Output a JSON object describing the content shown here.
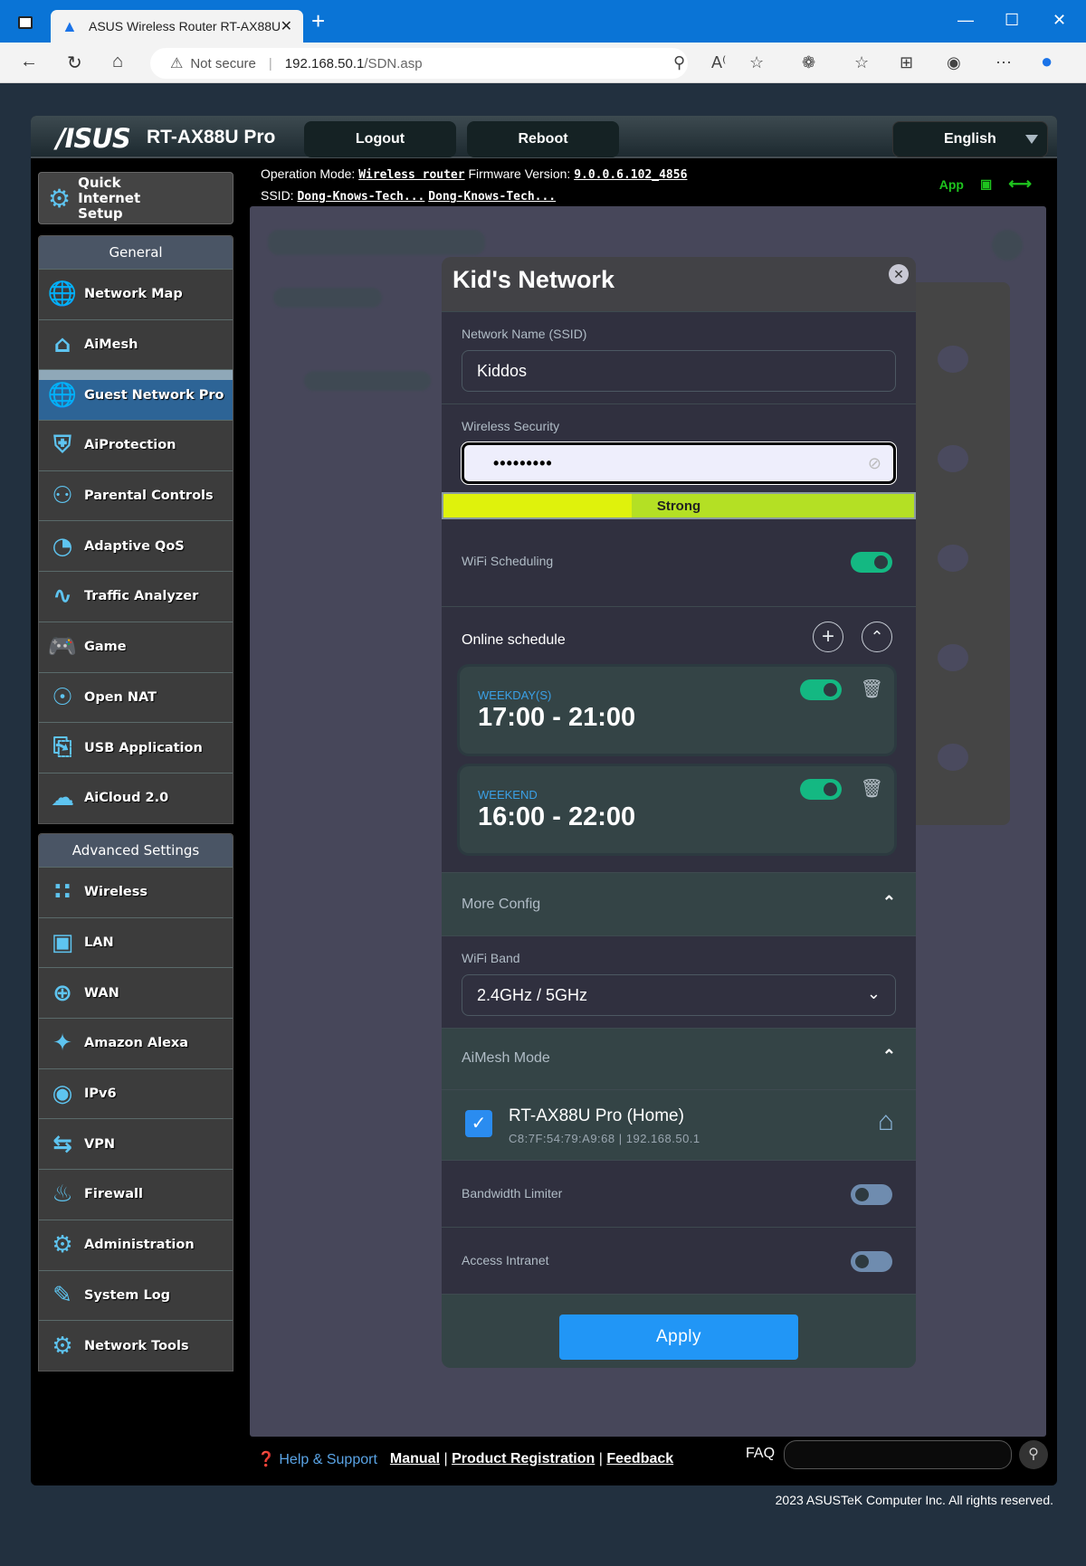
{
  "browser": {
    "tab_title": "ASUS Wireless Router RT-AX88U",
    "security_label": "Not secure",
    "url_host": "192.168.50.1",
    "url_path": "/SDN.asp"
  },
  "router": {
    "brand": "/ISUS",
    "model": "RT-AX88U Pro",
    "logout_label": "Logout",
    "reboot_label": "Reboot",
    "language": "English",
    "operation_mode_label": "Operation Mode:",
    "operation_mode": "Wireless router",
    "firmware_label": "Firmware Version:",
    "firmware": "9.0.0.6.102_4856",
    "ssid_label": "SSID:",
    "ssid_1": "Dong-Knows-Tech...",
    "ssid_2": "Dong-Knows-Tech...",
    "app_label": "App"
  },
  "sidebar": {
    "quick_setup": "Quick Internet Setup",
    "general_header": "General",
    "general_items": [
      {
        "label": "Network Map",
        "icon": "globe-pin-icon"
      },
      {
        "label": "AiMesh",
        "icon": "mesh-house-icon"
      },
      {
        "label": "Guest Network Pro",
        "icon": "guest-globe-icon",
        "active": true
      },
      {
        "label": "AiProtection",
        "icon": "shield-lock-icon"
      },
      {
        "label": "Parental Controls",
        "icon": "family-lock-icon"
      },
      {
        "label": "Adaptive QoS",
        "icon": "speedometer-icon"
      },
      {
        "label": "Traffic Analyzer",
        "icon": "pulse-icon"
      },
      {
        "label": "Game",
        "icon": "gamepad-icon"
      },
      {
        "label": "Open NAT",
        "icon": "open-nat-icon"
      },
      {
        "label": "USB Application",
        "icon": "usb-drive-icon"
      },
      {
        "label": "AiCloud 2.0",
        "icon": "cloud-icon"
      }
    ],
    "advanced_header": "Advanced Settings",
    "advanced_items": [
      {
        "label": "Wireless",
        "icon": "wifi-icon"
      },
      {
        "label": "LAN",
        "icon": "ethernet-icon"
      },
      {
        "label": "WAN",
        "icon": "globe-icon"
      },
      {
        "label": "Amazon Alexa",
        "icon": "alexa-icon"
      },
      {
        "label": "IPv6",
        "icon": "ipv6-icon"
      },
      {
        "label": "VPN",
        "icon": "vpn-monitor-icon"
      },
      {
        "label": "Firewall",
        "icon": "firewall-icon"
      },
      {
        "label": "Administration",
        "icon": "admin-gear-icon"
      },
      {
        "label": "System Log",
        "icon": "log-icon"
      },
      {
        "label": "Network Tools",
        "icon": "tools-gear-icon"
      }
    ]
  },
  "modal": {
    "title": "Kid's Network",
    "ssid_label": "Network Name (SSID)",
    "ssid_value": "Kiddos",
    "security_label": "Wireless Security",
    "password_mask": "•••••••••",
    "strength_label": "Strong",
    "strength_fraction": 0.4,
    "wifi_scheduling_label": "WiFi Scheduling",
    "wifi_scheduling_on": true,
    "online_schedule_label": "Online schedule",
    "schedules": [
      {
        "days": "WEEKDAY(S)",
        "time": "17:00 - 21:00",
        "enabled": true
      },
      {
        "days": "WEEKEND",
        "time": "16:00 - 22:00",
        "enabled": true
      }
    ],
    "more_config_label": "More Config",
    "wifi_band_label": "WiFi Band",
    "wifi_band_value": "2.4GHz / 5GHz",
    "aimesh_label": "AiMesh Mode",
    "aimesh_node_name": "RT-AX88U Pro (Home)",
    "aimesh_node_info": "C8:7F:54:79:A9:68 | 192.168.50.1",
    "aimesh_node_checked": true,
    "bandwidth_limiter_label": "Bandwidth Limiter",
    "bandwidth_limiter_on": false,
    "access_intranet_label": "Access Intranet",
    "access_intranet_on": false,
    "apply_label": "Apply"
  },
  "footer": {
    "help": "Help & Support",
    "manual": "Manual",
    "registration": "Product Registration",
    "feedback": "Feedback",
    "faq": "FAQ",
    "copyright": "2023 ASUSTeK Computer Inc. All rights reserved."
  },
  "colors": {
    "accent": "#2196f6",
    "toggle_on": "#14b882",
    "toggle_off": "#6f8caf",
    "strength_bar": "#b4e024",
    "active_nav": "#2d6496",
    "status_green": "#1ec41e"
  }
}
